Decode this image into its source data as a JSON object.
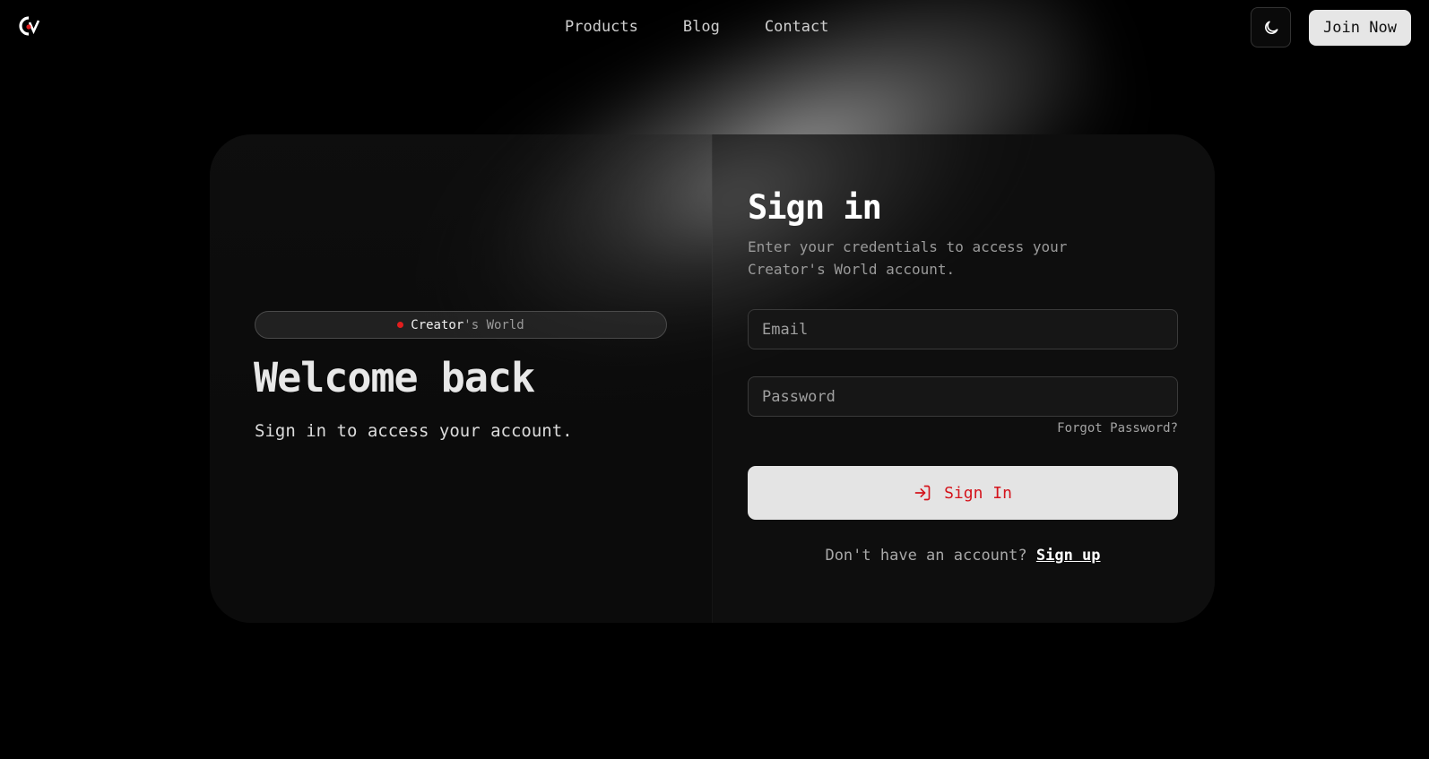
{
  "header": {
    "nav": [
      "Products",
      "Blog",
      "Contact"
    ],
    "theme_toggle_icon": "moon-icon",
    "join_label": "Join Now",
    "logo_icon": "creators-world-logo"
  },
  "hero": {
    "badge_part1": "Creator",
    "badge_part2": "'s World",
    "title": "Welcome back",
    "subtitle": "Sign in to access your account."
  },
  "form": {
    "title": "Sign in",
    "description": "Enter your credentials to access your Creator's World account.",
    "email_placeholder": "Email",
    "password_placeholder": "Password",
    "forgot_label": "Forgot Password?",
    "submit_label": "Sign In",
    "submit_icon": "log-in-icon",
    "no_account_text": "Don't have an account?",
    "signup_label": "Sign up"
  },
  "colors": {
    "background": "#000000",
    "accent": "#d4141c",
    "button_bg": "#e4e4e4"
  }
}
